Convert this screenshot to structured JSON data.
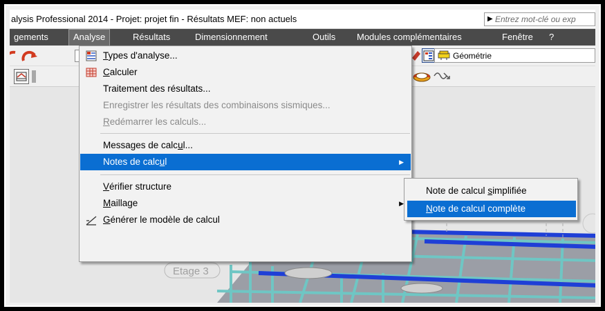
{
  "window": {
    "title": "alysis Professional 2014 - Projet: projet fin - Résultats MEF: non actuels",
    "search_placeholder": "Entrez mot-clé ou exp"
  },
  "menubar": {
    "items": [
      "gements",
      "Analyse",
      "Résultats",
      "Dimensionnement",
      "Outils",
      "Modules complémentaires",
      "Fenêtre",
      "?"
    ],
    "active": "Analyse"
  },
  "toolbar": {
    "geometry_label": "Géométrie"
  },
  "analyse_menu": {
    "types_analyse": {
      "pre": "",
      "accel": "T",
      "post": "ypes d'analyse..."
    },
    "calculer": {
      "pre": "",
      "accel": "C",
      "post": "alculer"
    },
    "traitement": "Traitement des résultats...",
    "enregistrer": "Enregistrer les résultats des combinaisons sismiques...",
    "redemarrer": {
      "pre": "",
      "accel": "R",
      "post": "edémarrer les calculs..."
    },
    "messages": {
      "pre": "Messages de calc",
      "accel": "u",
      "post": "l..."
    },
    "notes": {
      "pre": "Notes de calc",
      "accel": "u",
      "post": "l"
    },
    "verifier": {
      "pre": "",
      "accel": "V",
      "post": "érifier structure"
    },
    "maillage": {
      "pre": "",
      "accel": "M",
      "post": "aillage"
    },
    "generer": {
      "pre": "",
      "accel": "G",
      "post": "énérer le modèle de calcul"
    }
  },
  "notes_submenu": {
    "simplifiee": {
      "pre": "Note de calcul ",
      "accel": "s",
      "post": "implifiée"
    },
    "complete": {
      "pre": "",
      "accel": "N",
      "post": "ote de calcul complète"
    }
  },
  "viewport": {
    "level_label": "Etage 3"
  },
  "colors": {
    "menubar_bg": "#4a4a4a",
    "highlight": "#0a6ed2",
    "structure_cyan": "#6fc6c4",
    "beam_blue": "#1f3fd6"
  }
}
